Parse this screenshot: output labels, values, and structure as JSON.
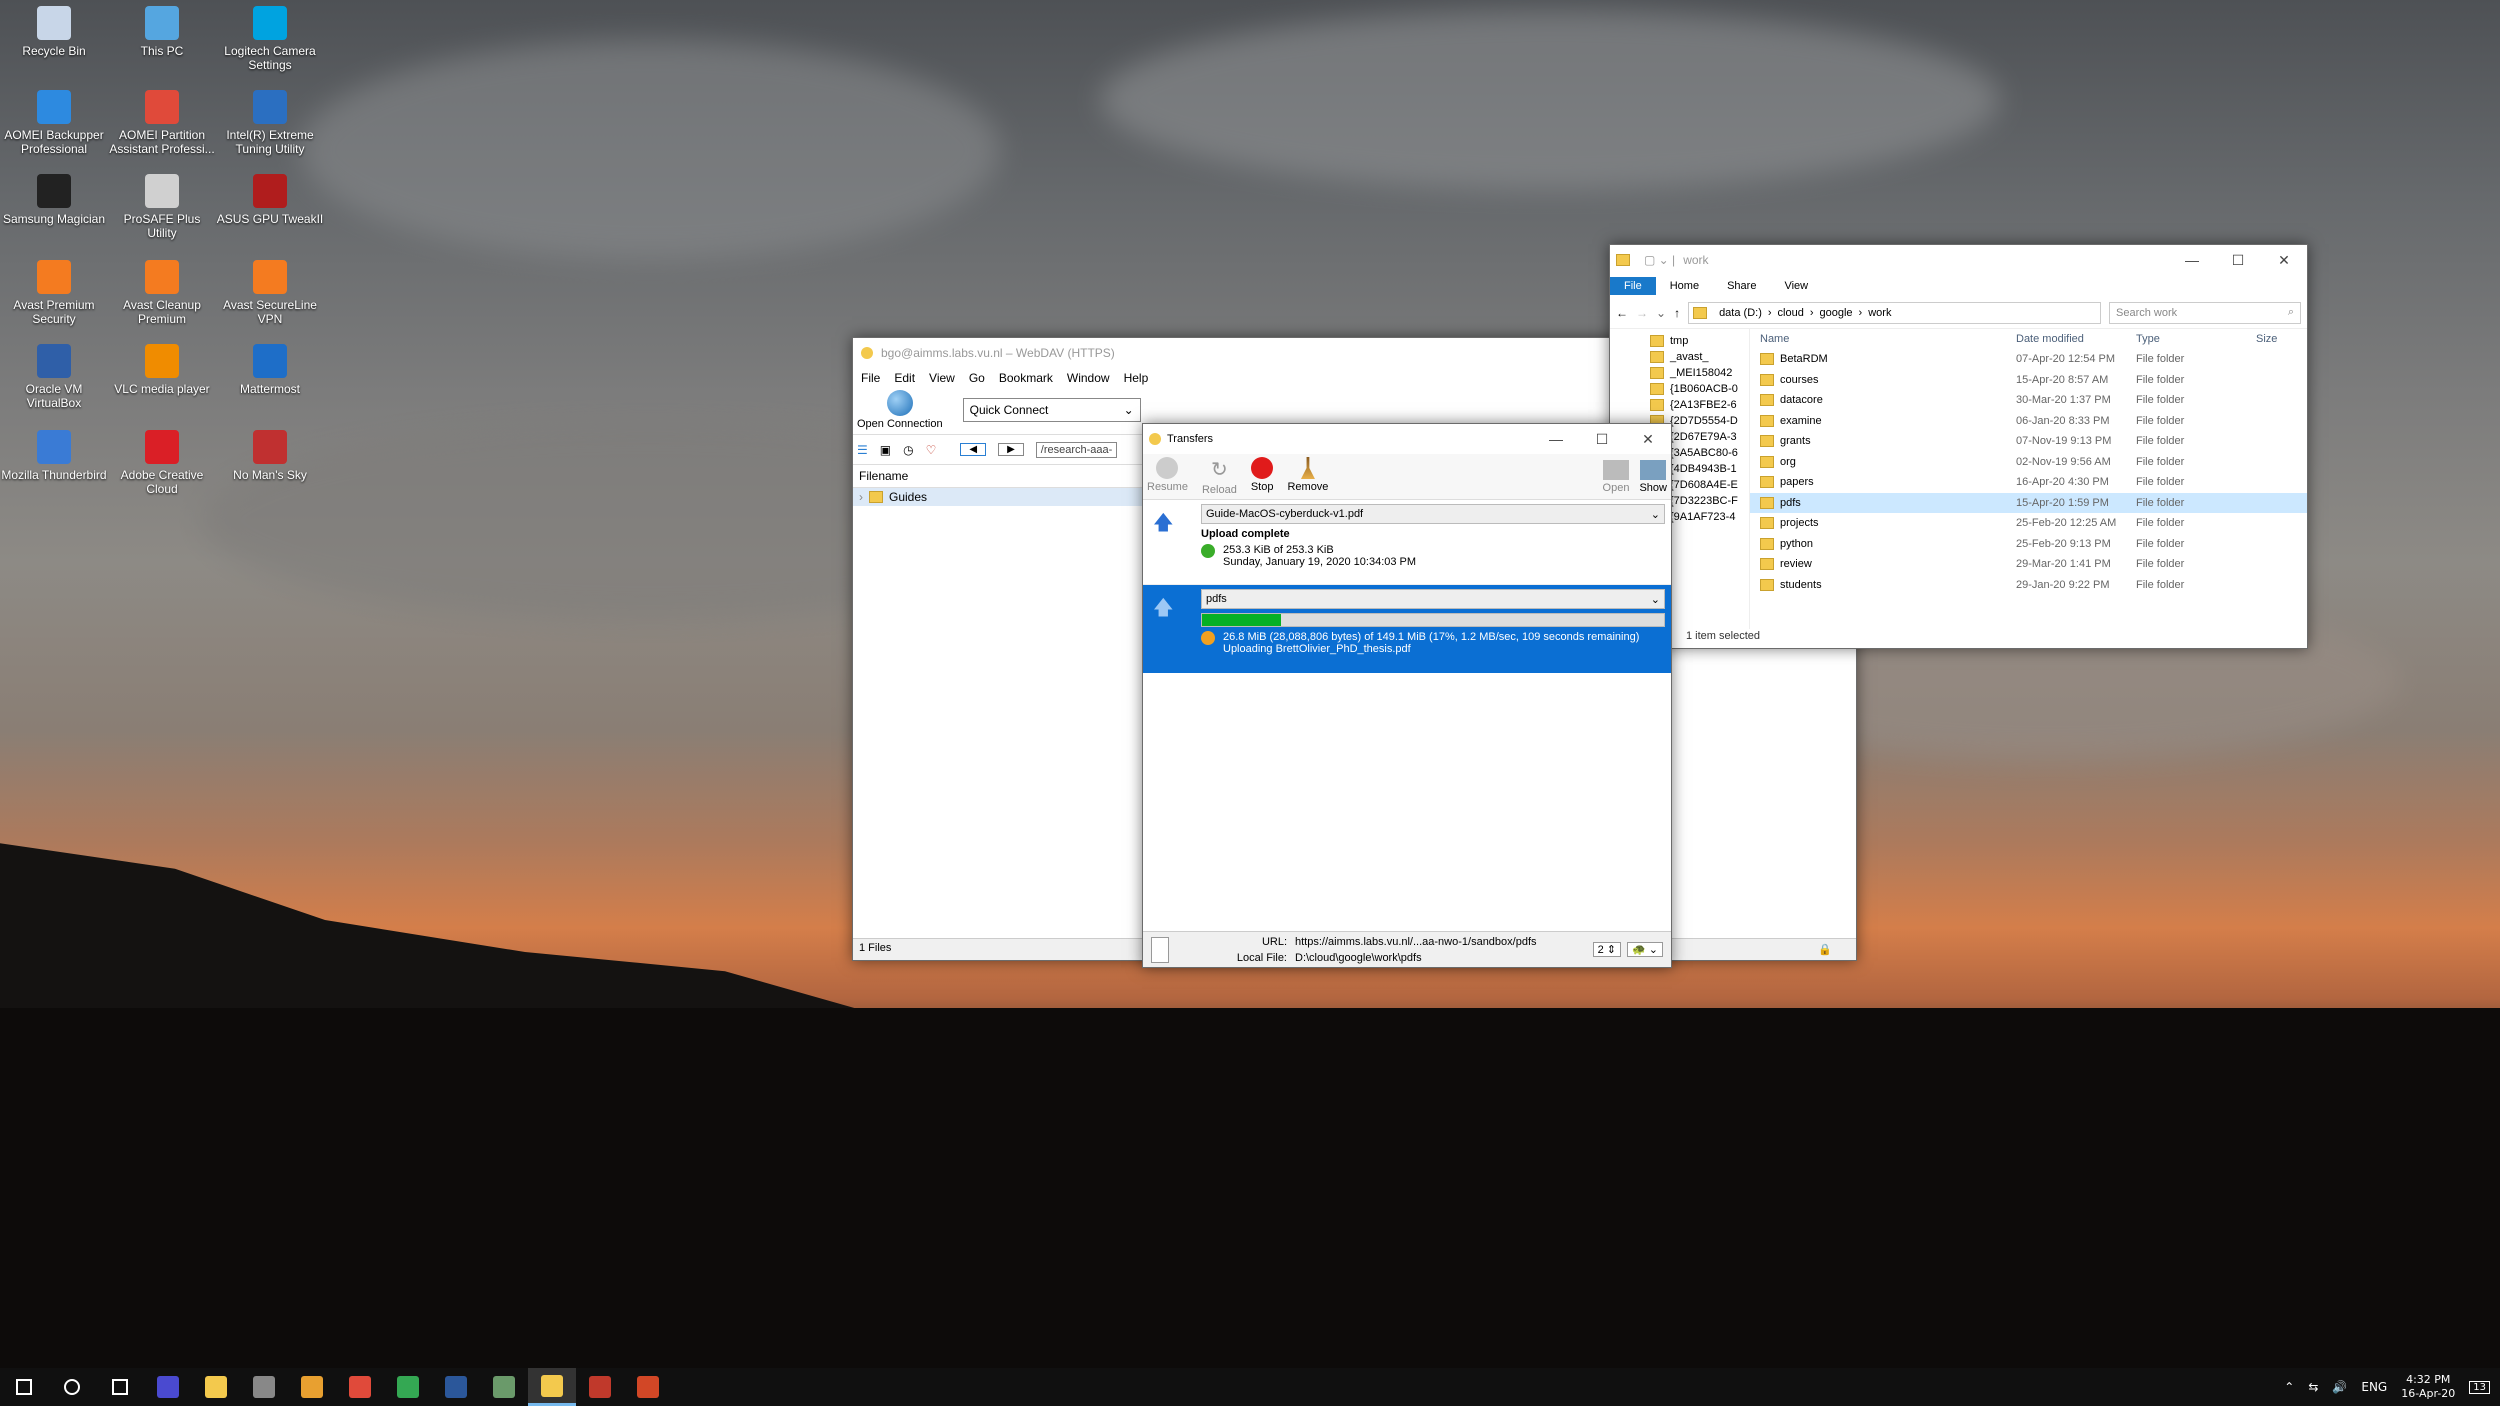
{
  "desktop": {
    "icons": [
      {
        "label": "Recycle Bin",
        "icon": "recycle-bin-icon",
        "color": "#c8d6e8"
      },
      {
        "label": "This PC",
        "icon": "this-pc-icon",
        "color": "#55a6e0"
      },
      {
        "label": "Logitech Camera Settings",
        "icon": "logitech-camera-icon",
        "color": "#00a3e0"
      },
      {
        "label": "AOMEI Backupper Professional",
        "icon": "aomei-backupper-icon",
        "color": "#2d8ae0"
      },
      {
        "label": "AOMEI Partition Assistant Professi...",
        "icon": "aomei-partition-icon",
        "color": "#e04a3a"
      },
      {
        "label": "Intel(R) Extreme Tuning Utility",
        "icon": "intel-xtu-icon",
        "color": "#2b6fc1"
      },
      {
        "label": "Samsung Magician",
        "icon": "samsung-magician-icon",
        "color": "#222"
      },
      {
        "label": "ProSAFE Plus Utility",
        "icon": "prosafe-icon",
        "color": "#d0d0d0"
      },
      {
        "label": "ASUS GPU TweakII",
        "icon": "asus-gpu-tweak-icon",
        "color": "#b01d1d"
      },
      {
        "label": "Avast Premium Security",
        "icon": "avast-premium-icon",
        "color": "#f47b20"
      },
      {
        "label": "Avast Cleanup Premium",
        "icon": "avast-cleanup-icon",
        "color": "#f47b20"
      },
      {
        "label": "Avast SecureLine VPN",
        "icon": "avast-vpn-icon",
        "color": "#f47b20"
      },
      {
        "label": "Oracle VM VirtualBox",
        "icon": "virtualbox-icon",
        "color": "#2f5fa8"
      },
      {
        "label": "VLC media player",
        "icon": "vlc-icon",
        "color": "#f08c00"
      },
      {
        "label": "Mattermost",
        "icon": "mattermost-icon",
        "color": "#1e6ec8"
      },
      {
        "label": "Mozilla Thunderbird",
        "icon": "thunderbird-icon",
        "color": "#3a7bd5"
      },
      {
        "label": "Adobe Creative Cloud",
        "icon": "creative-cloud-icon",
        "color": "#da1f26"
      },
      {
        "label": "No Man's Sky",
        "icon": "no-mans-sky-icon",
        "color": "#c03030"
      }
    ]
  },
  "cyberduck": {
    "title": "bgo@aimms.labs.vu.nl – WebDAV (HTTPS)",
    "menu": [
      "File",
      "Edit",
      "View",
      "Go",
      "Bookmark",
      "Window",
      "Help"
    ],
    "open_connection": "Open Connection",
    "quick_connect": "Quick Connect",
    "path": "/research-aaa-",
    "column_filename": "Filename",
    "row": "Guides",
    "status": "1 Files"
  },
  "transfers": {
    "title": "Transfers",
    "buttons": {
      "resume": "Resume",
      "reload": "Reload",
      "stop": "Stop",
      "remove": "Remove",
      "open": "Open",
      "show": "Show"
    },
    "items": [
      {
        "name": "Guide-MacOS-cyberduck-v1.pdf",
        "status": "Upload complete",
        "size": "253.3 KiB of 253.3 KiB",
        "date": "Sunday, January 19, 2020 10:34:03 PM",
        "progress": 1.0
      },
      {
        "name": "pdfs",
        "status": "26.8 MiB (28,088,806 bytes) of 149.1 MiB (17%, 1.2 MB/sec, 109 seconds remaining)",
        "file": "Uploading BrettOlivier_PhD_thesis.pdf",
        "progress": 0.17
      }
    ],
    "url_label": "URL:",
    "url": "https://aimms.labs.vu.nl/...aa-nwo-1/sandbox/pdfs",
    "local_label": "Local File:",
    "local": "D:\\cloud\\google\\work\\pdfs",
    "connections": "2"
  },
  "explorer": {
    "title": "work",
    "ribbon": [
      "File",
      "Home",
      "Share",
      "View"
    ],
    "breadcrumb": [
      "data (D:)",
      "cloud",
      "google",
      "work"
    ],
    "search_placeholder": "Search work",
    "tree": [
      "tmp",
      "_avast_",
      "_MEI158042",
      "{1B060ACB-0",
      "{2A13FBE2-6",
      "{2D7D5554-D",
      "{2D67E79A-3",
      "{3A5ABC80-6",
      "{4DB4943B-1",
      "{7D608A4E-E",
      "{7D3223BC-F",
      "{9A1AF723-4"
    ],
    "columns": [
      "Name",
      "Date modified",
      "Type",
      "Size"
    ],
    "rows": [
      {
        "name": "BetaRDM",
        "date": "07-Apr-20 12:54 PM",
        "type": "File folder"
      },
      {
        "name": "courses",
        "date": "15-Apr-20 8:57 AM",
        "type": "File folder"
      },
      {
        "name": "datacore",
        "date": "30-Mar-20 1:37 PM",
        "type": "File folder"
      },
      {
        "name": "examine",
        "date": "06-Jan-20 8:33 PM",
        "type": "File folder"
      },
      {
        "name": "grants",
        "date": "07-Nov-19 9:13 PM",
        "type": "File folder"
      },
      {
        "name": "org",
        "date": "02-Nov-19 9:56 AM",
        "type": "File folder"
      },
      {
        "name": "papers",
        "date": "16-Apr-20 4:30 PM",
        "type": "File folder"
      },
      {
        "name": "pdfs",
        "date": "15-Apr-20 1:59 PM",
        "type": "File folder"
      },
      {
        "name": "projects",
        "date": "25-Feb-20 12:25 AM",
        "type": "File folder"
      },
      {
        "name": "python",
        "date": "25-Feb-20 9:13 PM",
        "type": "File folder"
      },
      {
        "name": "review",
        "date": "29-Mar-20 1:41 PM",
        "type": "File folder"
      },
      {
        "name": "students",
        "date": "29-Jan-20 9:22 PM",
        "type": "File folder"
      }
    ],
    "selected_index": 7,
    "status": "1 item selected"
  },
  "taskbar": {
    "apps": [
      {
        "name": "start-button",
        "color": "#ffffff"
      },
      {
        "name": "search-icon",
        "color": "#ffffff"
      },
      {
        "name": "task-view-icon",
        "color": "#ffffff"
      },
      {
        "name": "taskbar-app-1",
        "color": "#4a4ad0"
      },
      {
        "name": "file-explorer-icon",
        "color": "#f3c94d"
      },
      {
        "name": "taskbar-app-3",
        "color": "#888888"
      },
      {
        "name": "taskbar-app-4",
        "color": "#e8a030"
      },
      {
        "name": "chrome-icon",
        "color": "#e04a3a"
      },
      {
        "name": "chrome-icon",
        "color": "#34a853"
      },
      {
        "name": "word-icon",
        "color": "#2b579a"
      },
      {
        "name": "taskbar-app-8",
        "color": "#6a9a6a"
      },
      {
        "name": "cyberduck-icon",
        "color": "#f3c94d"
      },
      {
        "name": "taskbar-app-10",
        "color": "#c0392b"
      },
      {
        "name": "powerpoint-icon",
        "color": "#d24726"
      }
    ],
    "lang": "ENG",
    "time": "4:32 PM",
    "date": "16-Apr-20",
    "notification_count": "13"
  }
}
